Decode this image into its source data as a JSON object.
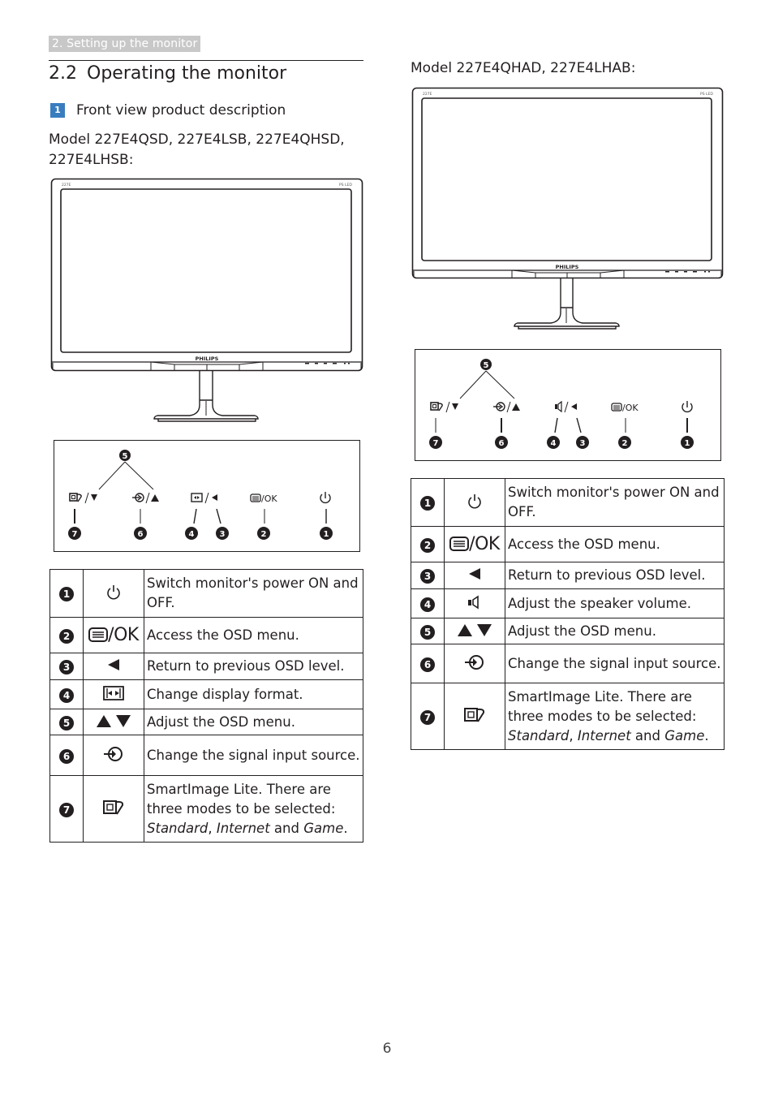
{
  "header": {
    "section_chip": "2. Setting up the monitor",
    "section_number": "2.2",
    "section_title": "Operating the monitor"
  },
  "subsection": {
    "badge": "1",
    "title": "Front view product description"
  },
  "left": {
    "model_line1": "Model 227E4QSD, 227E4LSB, 227E4QHSD,",
    "model_line2": "227E4LHSB:",
    "monitor": {
      "brand": "PHILIPS",
      "model_tag": "227E",
      "panel_tag": "PS LED"
    },
    "diagram": {
      "labels": [
        "1",
        "2",
        "3",
        "4",
        "5",
        "6",
        "7"
      ],
      "ok_label": "/OK"
    },
    "rows": [
      {
        "num": "1",
        "icon": "power-icon",
        "desc": "Switch monitor's power ON and OFF."
      },
      {
        "num": "2",
        "icon": "menu-ok-icon",
        "icon_text": "/OK",
        "desc": "Access the OSD menu."
      },
      {
        "num": "3",
        "icon": "left-triangle-icon",
        "desc": "Return to previous OSD level."
      },
      {
        "num": "4",
        "icon": "display-format-icon",
        "desc": "Change display format."
      },
      {
        "num": "5",
        "icon": "up-down-triangles-icon",
        "desc": "Adjust the OSD menu."
      },
      {
        "num": "6",
        "icon": "input-source-icon",
        "desc": "Change the signal input source."
      },
      {
        "num": "7",
        "icon": "smartimage-icon",
        "desc_pre": "SmartImage Lite. There are three modes to be selected: ",
        "mode1": "Standard",
        "sep1": ", ",
        "mode2": "Internet",
        "sep2": " and ",
        "mode3": "Game",
        "end": "."
      }
    ]
  },
  "right": {
    "model_line": "Model 227E4QHAD, 227E4LHAB:",
    "monitor": {
      "brand": "PHILIPS",
      "model_tag": "227E",
      "panel_tag": "PS LED"
    },
    "diagram": {
      "labels": [
        "1",
        "2",
        "3",
        "4",
        "5",
        "6",
        "7"
      ],
      "ok_label": "/OK"
    },
    "rows": [
      {
        "num": "1",
        "icon": "power-icon",
        "desc": "Switch monitor's power ON and OFF."
      },
      {
        "num": "2",
        "icon": "menu-ok-icon",
        "icon_text": "/OK",
        "desc": "Access the OSD menu."
      },
      {
        "num": "3",
        "icon": "left-triangle-icon",
        "desc": "Return to previous OSD level."
      },
      {
        "num": "4",
        "icon": "speaker-icon",
        "desc": "Adjust the speaker volume."
      },
      {
        "num": "5",
        "icon": "up-down-triangles-icon",
        "desc": "Adjust the OSD menu."
      },
      {
        "num": "6",
        "icon": "input-source-icon",
        "desc": "Change the signal input source."
      },
      {
        "num": "7",
        "icon": "smartimage-icon",
        "desc_pre": "SmartImage Lite. There are three modes to be selected: ",
        "mode1": "Standard",
        "sep1": ", ",
        "mode2": "Internet",
        "sep2": " and ",
        "mode3": "Game",
        "end": "."
      }
    ]
  },
  "footer": {
    "page_number": "6"
  }
}
